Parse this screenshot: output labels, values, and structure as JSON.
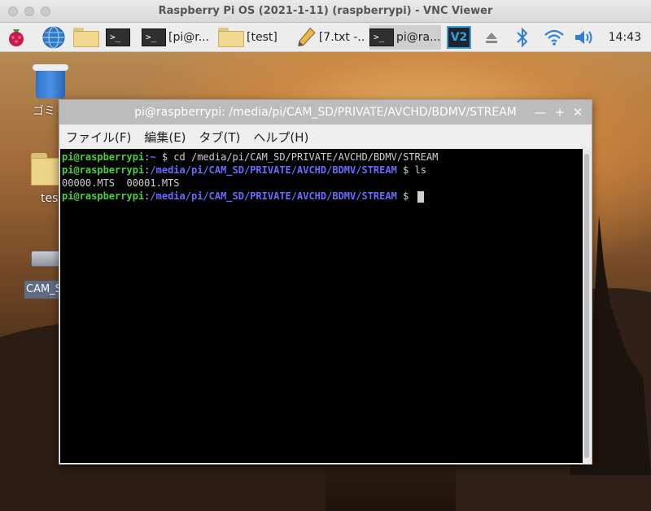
{
  "app_title": "Raspberry Pi OS (2021-1-11) (raspberrypi) - VNC Viewer",
  "taskbar": {
    "items": [
      {
        "label": "[pi@r..."
      },
      {
        "label": "[test]"
      },
      {
        "label": "[7.txt -..."
      },
      {
        "label": "pi@ra..."
      }
    ],
    "clock": "14:43"
  },
  "desktop": {
    "trash_label": "ゴミ",
    "folder_label": "test",
    "drive_label": "CAM_SD"
  },
  "terminal": {
    "title": "pi@raspberrypi: /media/pi/CAM_SD/PRIVATE/AVCHD/BDMV/STREAM",
    "menu": [
      "ファイル(F)",
      "編集(E)",
      "タブ(T)",
      "ヘルプ(H)"
    ],
    "lines": [
      {
        "user": "pi@raspberrypi",
        "sep": ":",
        "path": "~",
        "prompt": " $",
        "cmd": " cd /media/pi/CAM_SD/PRIVATE/AVCHD/BDMV/STREAM"
      },
      {
        "user": "pi@raspberrypi",
        "sep": ":",
        "path": "/media/pi/CAM_SD/PRIVATE/AVCHD/BDMV/STREAM",
        "prompt": " $",
        "cmd": " ls"
      },
      {
        "output": "00000.MTS  00001.MTS"
      },
      {
        "user": "pi@raspberrypi",
        "sep": ":",
        "path": "/media/pi/CAM_SD/PRIVATE/AVCHD/BDMV/STREAM",
        "prompt": " $",
        "cmd": " "
      }
    ]
  },
  "icons": [
    "raspberry-menu-icon",
    "globe-icon",
    "file-manager-icon",
    "terminal-icon",
    "pencil-icon",
    "vnc-icon",
    "eject-icon",
    "bluetooth-icon",
    "wifi-icon",
    "volume-icon"
  ],
  "colors": {
    "prompt_user": "#47d13d",
    "prompt_path": "#6b6bff",
    "terminal_bg": "#000000",
    "taskbar_bg": "#ededed"
  }
}
